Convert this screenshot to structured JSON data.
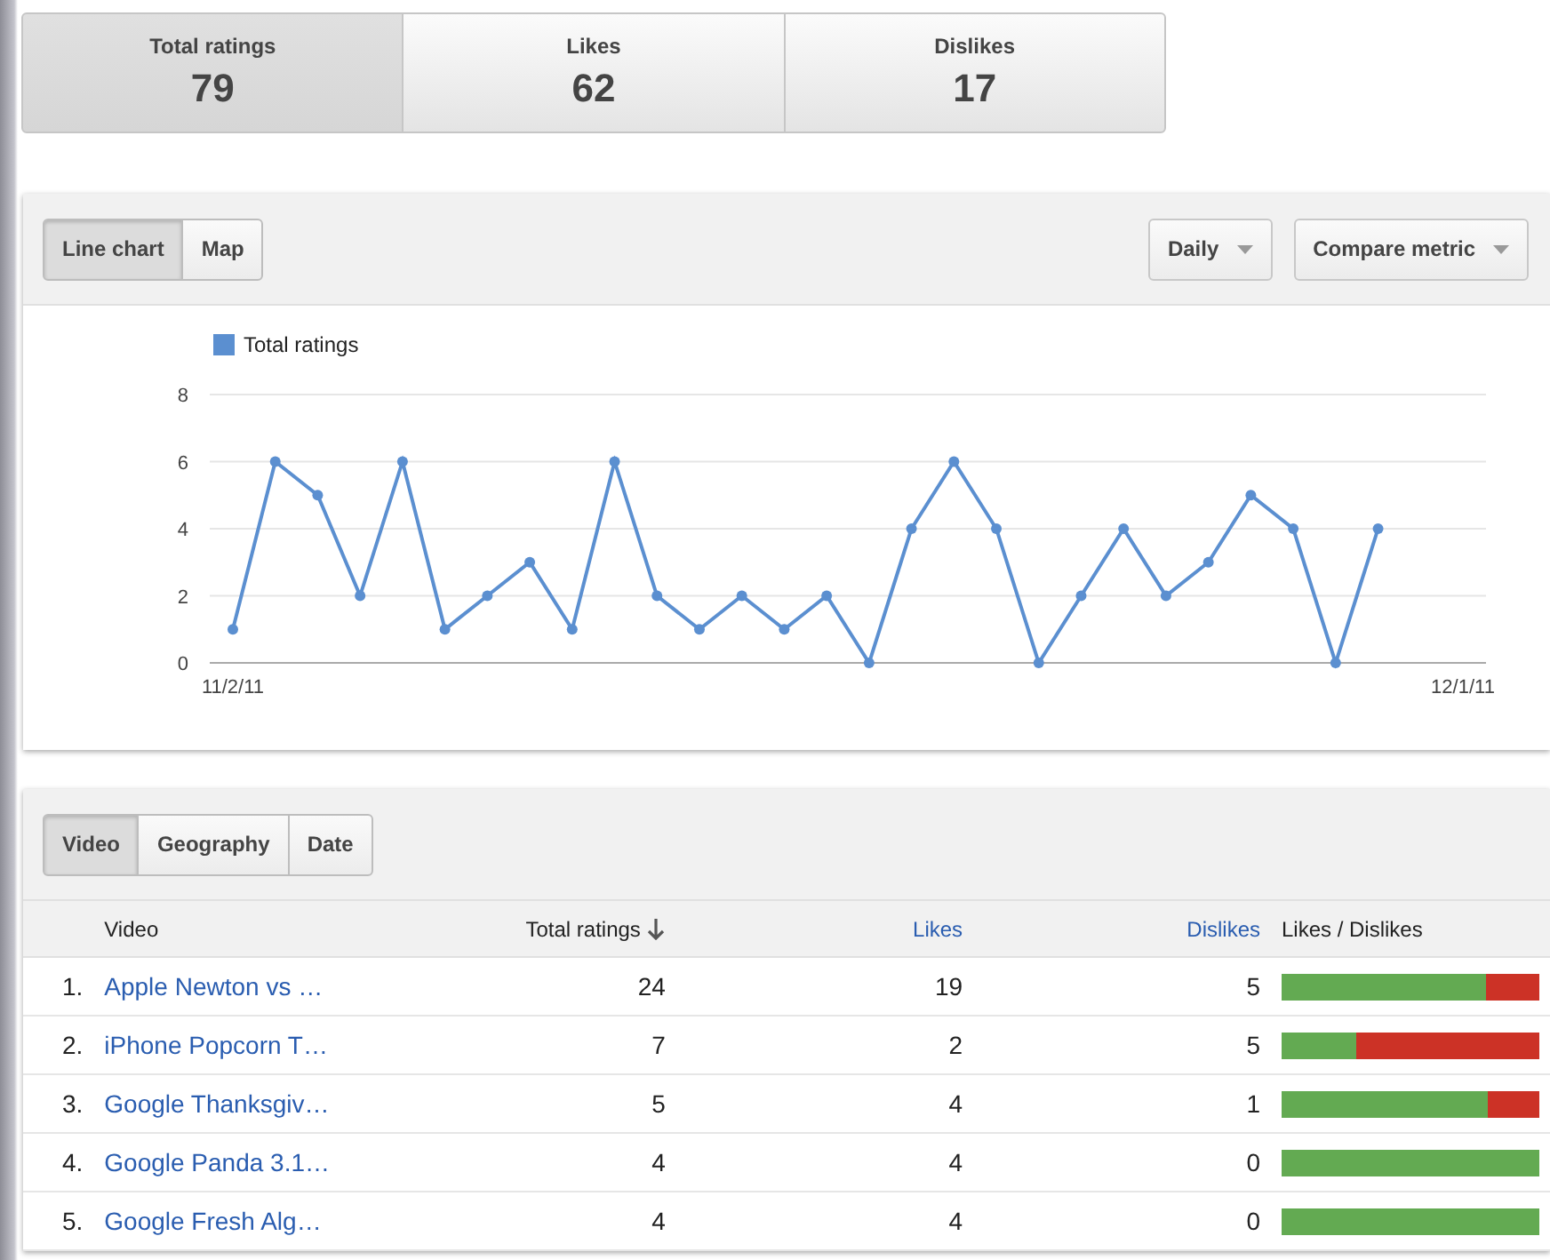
{
  "summary_cards": [
    {
      "label": "Total ratings",
      "value": "79",
      "selected": true
    },
    {
      "label": "Likes",
      "value": "62",
      "selected": false
    },
    {
      "label": "Dislikes",
      "value": "17",
      "selected": false
    }
  ],
  "chart_toolbar": {
    "view_tabs": [
      {
        "label": "Line chart",
        "selected": true
      },
      {
        "label": "Map",
        "selected": false
      }
    ],
    "dropdowns": [
      "Daily",
      "Compare metric"
    ]
  },
  "chart": {
    "chart_data": {
      "type": "line",
      "categories": [
        "11/2/11",
        null,
        null,
        null,
        null,
        null,
        null,
        null,
        null,
        null,
        null,
        null,
        null,
        null,
        null,
        null,
        null,
        null,
        null,
        null,
        null,
        null,
        null,
        null,
        null,
        null,
        null,
        null,
        null,
        "12/1/11"
      ],
      "grid": true,
      "series": [
        {
          "name": "Total ratings",
          "color": "#5b8fd0",
          "marker": true,
          "values": [
            1,
            6,
            5,
            2,
            6,
            1,
            2,
            3,
            1,
            6,
            2,
            1,
            2,
            1,
            2,
            0,
            4,
            6,
            4,
            0,
            2,
            4,
            2,
            3,
            5,
            4,
            0,
            4,
            null,
            null
          ]
        }
      ],
      "ylim": [
        0,
        8
      ],
      "yticks": [
        0,
        2,
        4,
        6,
        8
      ]
    }
  },
  "table_toolbar": {
    "tabs": [
      {
        "label": "Video",
        "selected": true
      },
      {
        "label": "Geography",
        "selected": false
      },
      {
        "label": "Date",
        "selected": false
      }
    ]
  },
  "table": {
    "columns": [
      {
        "label": "Video",
        "link": false,
        "sorted": false
      },
      {
        "label": "Total ratings",
        "link": false,
        "sorted": true
      },
      {
        "label": "Likes",
        "link": true,
        "sorted": false
      },
      {
        "label": "Dislikes",
        "link": true,
        "sorted": false
      },
      {
        "label": "Likes / Dislikes",
        "link": false,
        "sorted": false
      }
    ],
    "rows": [
      {
        "rank": "1.",
        "video": "Apple Newton vs …",
        "total": "24",
        "likes": "19",
        "dislikes": "5",
        "level": 0.79
      },
      {
        "rank": "2.",
        "video": "iPhone Popcorn T…",
        "total": "7",
        "likes": "2",
        "dislikes": "5",
        "level": 0.29
      },
      {
        "rank": "3.",
        "video": "Google Thanksgiv…",
        "total": "5",
        "likes": "4",
        "dislikes": "1",
        "level": 0.8
      },
      {
        "rank": "4.",
        "video": "Google Panda 3.1…",
        "total": "4",
        "likes": "4",
        "dislikes": "0",
        "level": 1
      },
      {
        "rank": "5.",
        "video": "Google Fresh Alg…",
        "total": "4",
        "likes": "4",
        "dislikes": "0",
        "level": 1
      }
    ]
  }
}
